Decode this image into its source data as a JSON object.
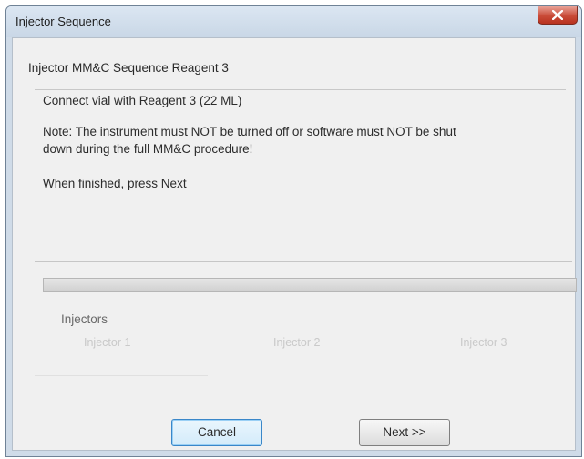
{
  "window": {
    "title": "Injector Sequence"
  },
  "header": {
    "sequence_title": "Injector MM&C Sequence Reagent 3"
  },
  "message": {
    "instruction": "Connect vial with Reagent 3 (22 ML)",
    "note_line1": "Note: The instrument must NOT be turned off or software must NOT be shut",
    "note_line2": "down during the full MM&C procedure!",
    "finish": "When finished, press Next"
  },
  "injectors": {
    "label": "Injectors",
    "items": [
      "Injector 1",
      "Injector 2",
      "Injector 3"
    ]
  },
  "buttons": {
    "cancel_label": "Cancel",
    "next_label": "Next >>"
  },
  "icons": {
    "close": "close-icon"
  },
  "colors": {
    "titlebar": "#cfdbe8",
    "close_button": "#c94b38",
    "focus_border": "#3a87c9"
  }
}
